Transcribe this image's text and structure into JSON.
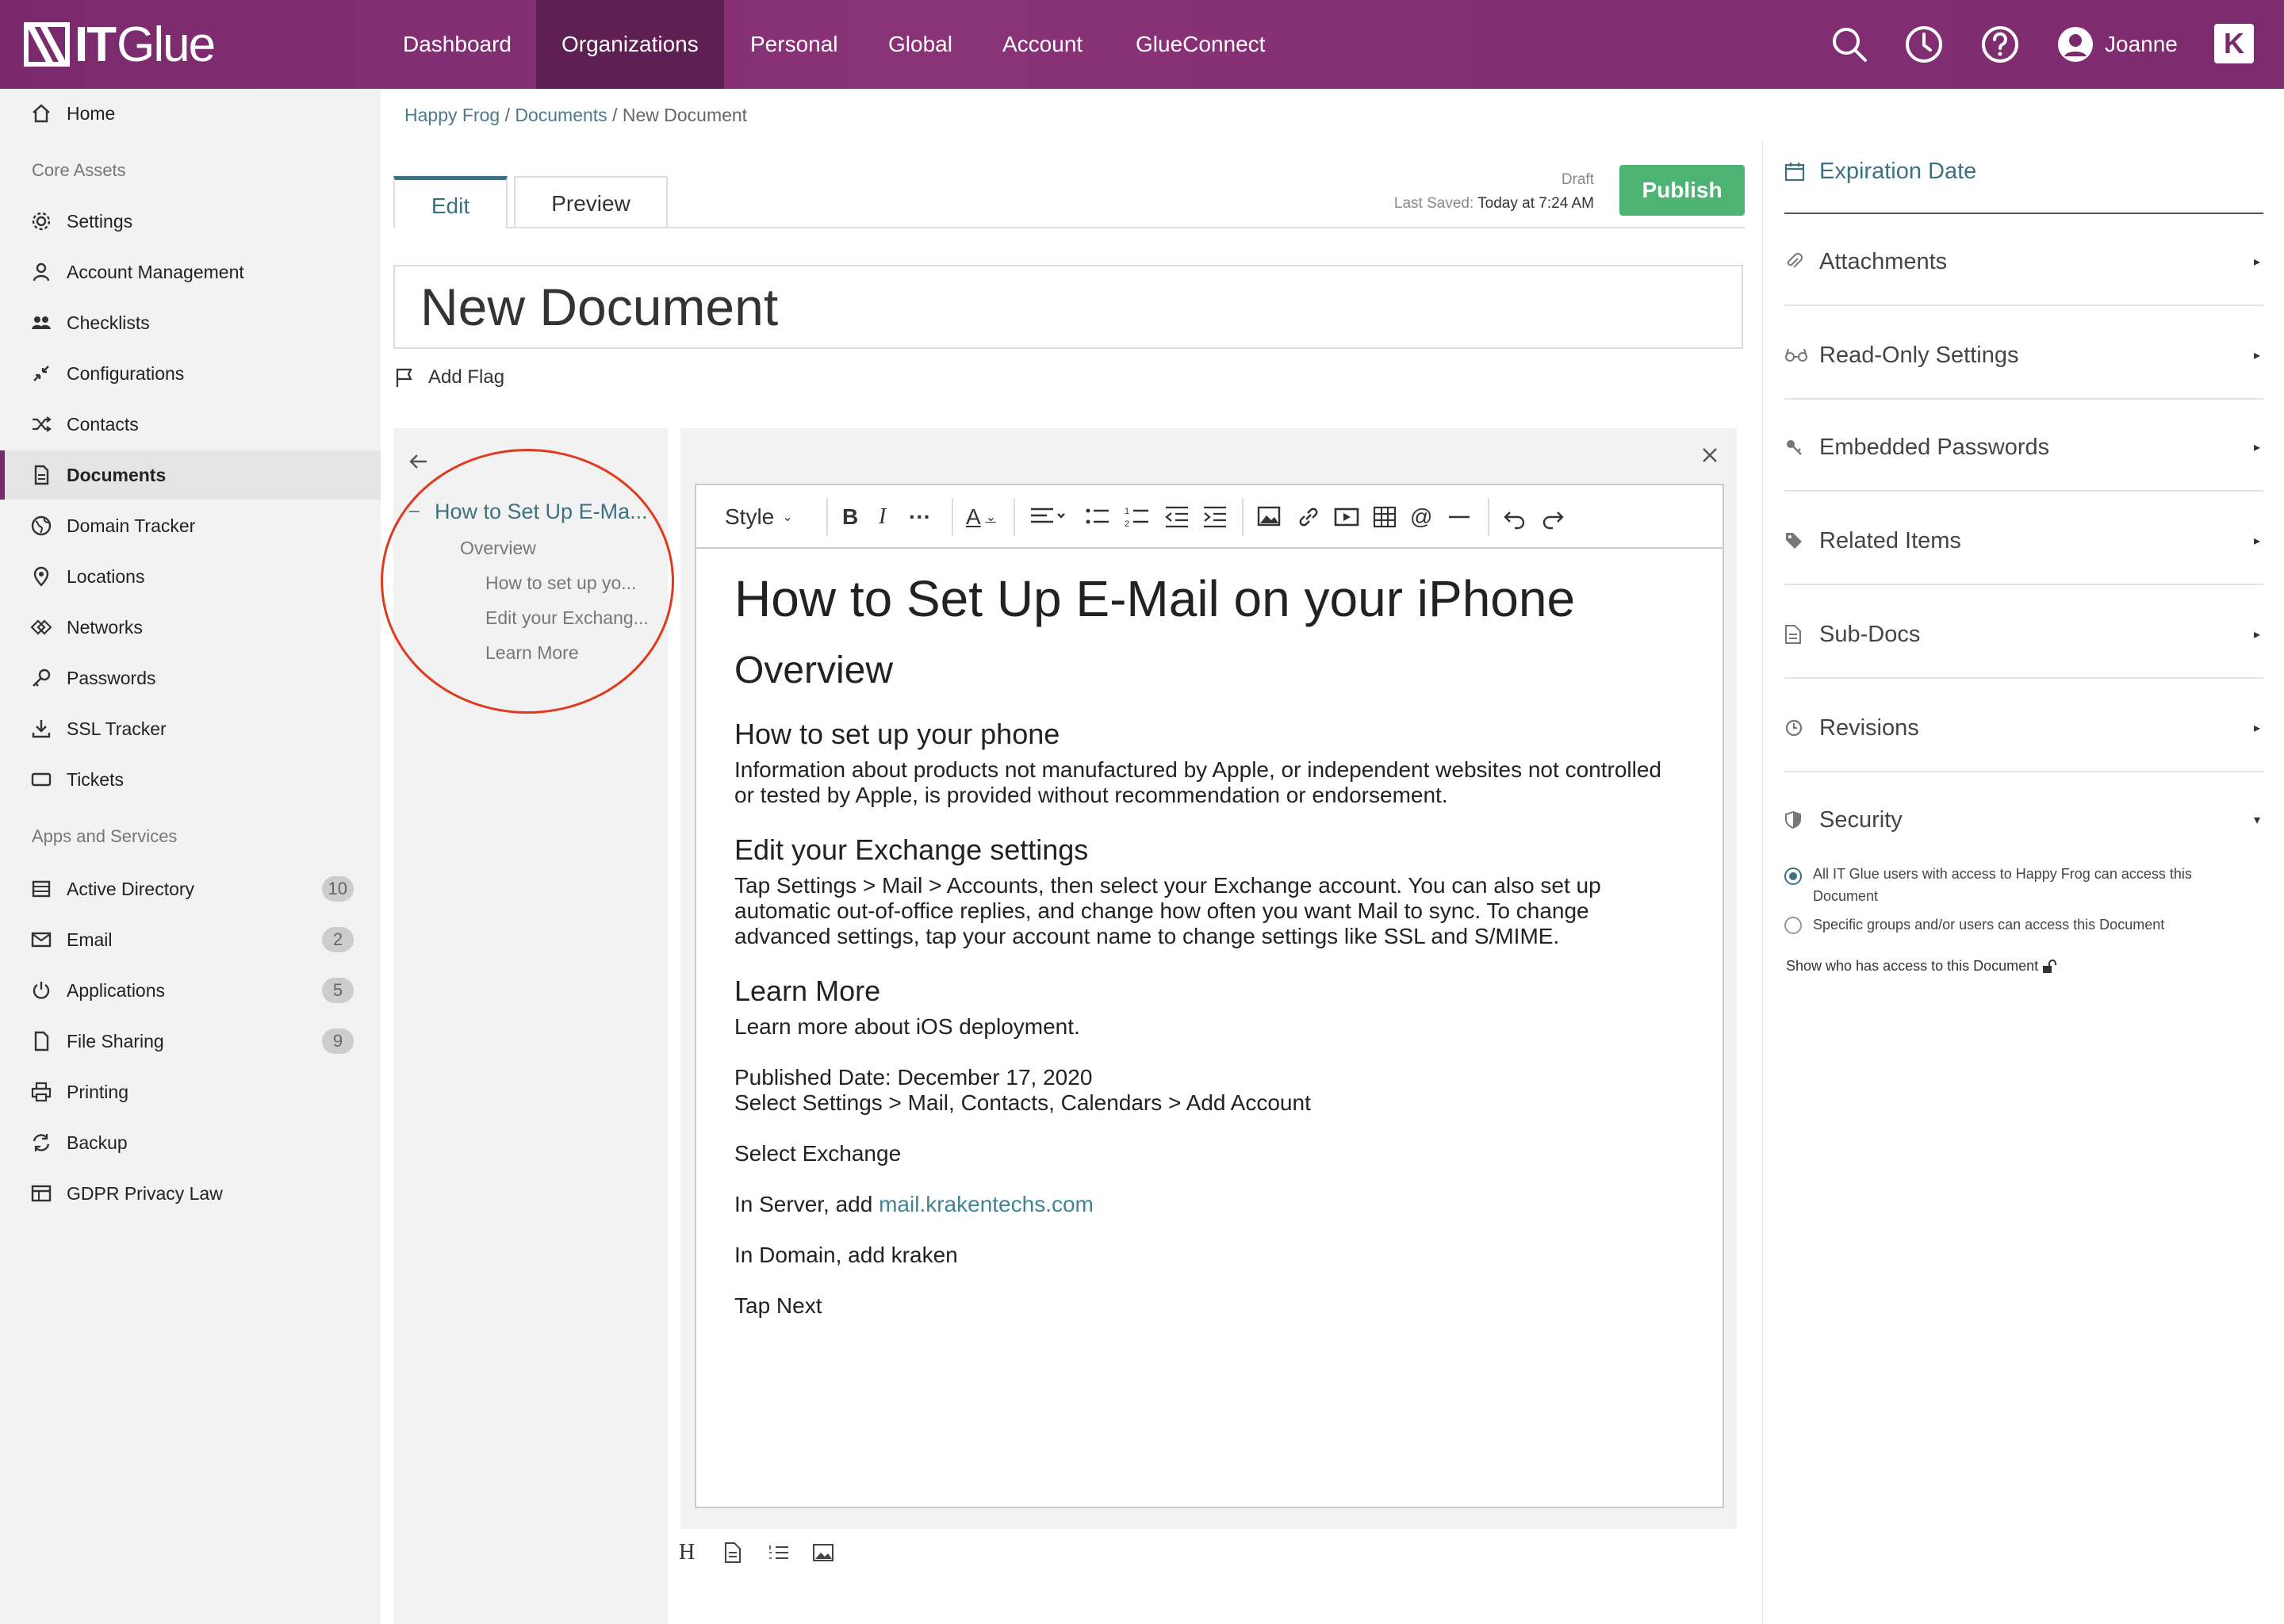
{
  "app": {
    "logo_text": "Glue",
    "logo_it": "IT"
  },
  "topnav": {
    "items": [
      "Dashboard",
      "Organizations",
      "Personal",
      "Global",
      "Account",
      "GlueConnect"
    ],
    "active": "Organizations",
    "user_name": "Joanne",
    "k_badge": "K"
  },
  "sidebar": {
    "home": "Home",
    "core_assets_heading": "Core Assets",
    "core": [
      "Settings",
      "Account Management",
      "Checklists",
      "Configurations",
      "Contacts",
      "Documents",
      "Domain Tracker",
      "Locations",
      "Networks",
      "Passwords",
      "SSL Tracker",
      "Tickets"
    ],
    "apps_heading": "Apps and Services",
    "apps": [
      {
        "label": "Active Directory",
        "badge": "10"
      },
      {
        "label": "Email",
        "badge": "2"
      },
      {
        "label": "Applications",
        "badge": "5"
      },
      {
        "label": "File Sharing",
        "badge": "9"
      },
      {
        "label": "Printing",
        "badge": ""
      },
      {
        "label": "Backup",
        "badge": ""
      },
      {
        "label": "GDPR Privacy Law",
        "badge": ""
      }
    ]
  },
  "breadcrumb": {
    "org": "Happy Frog",
    "section": "Documents",
    "current": "New Document",
    "sep": "/"
  },
  "tabs": {
    "edit": "Edit",
    "preview": "Preview"
  },
  "status": {
    "draft": "Draft",
    "last_saved_label": "Last Saved:",
    "last_saved_value": "Today at 7:24 AM"
  },
  "publish_label": "Publish",
  "doc_title": "New Document",
  "add_flag": "Add Flag",
  "toc": {
    "title": "How to Set Up E-Ma...",
    "items": [
      "Overview",
      "How to set  up yo...",
      "Edit your Exchang...",
      "Learn More"
    ]
  },
  "toolbar": {
    "style_label": "Style"
  },
  "content": {
    "h1": "How to Set Up E-Mail on your iPhone",
    "h2": "Overview",
    "s1_title": "How to set up your phone",
    "s1_body": "Information about products not manufactured by Apple, or independent websites not controlled or tested by Apple, is provided without recommendation or endorsement.",
    "s2_title": "Edit your Exchange settings",
    "s2_body": "Tap Settings > Mail > Accounts, then select your Exchange account. You can also set up automatic out-of-office replies, and change how often you want Mail to sync. To change advanced settings, tap your account name to change settings like SSL and S/MIME.",
    "s3_title": "Learn More",
    "s3_body": "Learn more about iOS deployment.",
    "published": "Published Date: December 17, 2020",
    "select_settings": "Select Settings > Mail, Contacts, Calendars > Add Account",
    "select_exchange": "Select Exchange",
    "server_prefix": "In Server, add ",
    "server_link": "mail.krakentechs.com",
    "domain": "In Domain, add kraken",
    "tap_next": "Tap Next"
  },
  "right_panel": {
    "expiration": "Expiration Date",
    "items": [
      "Attachments",
      "Read-Only Settings",
      "Embedded Passwords",
      "Related Items",
      "Sub-Docs",
      "Revisions"
    ],
    "security": "Security",
    "opt1": "All IT Glue users with access to Happy Frog can access this Document",
    "opt2": "Specific groups and/or users can access this Document",
    "show_access": "Show who has access to this Document"
  },
  "colors": {
    "brand": "#7a2a6c",
    "accent": "#3e7180",
    "publish": "#4cb372",
    "annotation": "#e03a1e"
  }
}
